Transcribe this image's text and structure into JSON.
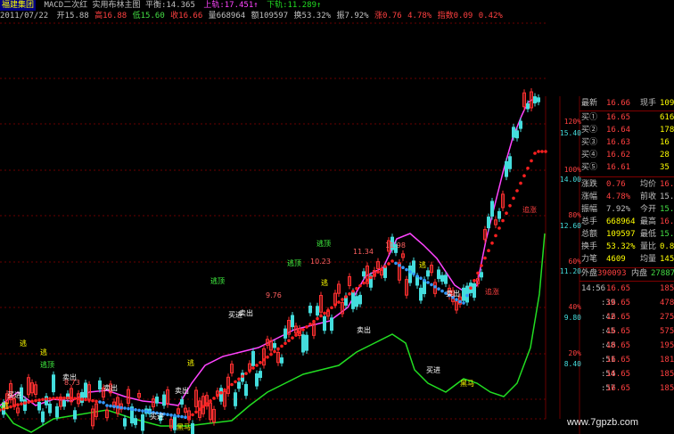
{
  "header": {
    "stock_name": "福建集团",
    "indicator_line": "MACD二次红  实用布林主图  平衡:14.365",
    "upper_label": "上轨:17.451↑",
    "lower_label": "下轨:11.289↑",
    "date": "2011/07/22",
    "open_label": "开15.88",
    "high_label": "高16.88",
    "low_label": "低15.60",
    "close_label": "收16.66",
    "volume_label": "量668964",
    "amount_label": "额109597",
    "turnover_label": "换53.32%",
    "amplitude_label": "振7.92%",
    "rise_label": "涨0.76",
    "rise_pct_label": "4.78%",
    "index_label": "指数0.09",
    "index_pct_label": "0.42%"
  },
  "right_axis": {
    "pct_labels": [
      "120%",
      "100%",
      "80%",
      "60%",
      "40%",
      "20%"
    ],
    "price_labels": [
      "15.40",
      "14.00",
      "12.60",
      "11.20",
      "9.80",
      "8.40"
    ]
  },
  "quote_panel": {
    "latest_label": "最新",
    "latest_value": "16.66",
    "now_hand_label": "现手",
    "now_hand_value": "1098",
    "buy_rows": [
      {
        "label": "买①",
        "price": "16.65",
        "vol": "616"
      },
      {
        "label": "买②",
        "price": "16.64",
        "vol": "178"
      },
      {
        "label": "买③",
        "price": "16.63",
        "vol": "16"
      },
      {
        "label": "买④",
        "price": "16.62",
        "vol": "28"
      },
      {
        "label": "买⑤",
        "price": "16.61",
        "vol": "35"
      }
    ],
    "stats": [
      {
        "l1": "涨跌",
        "v1": "0.76",
        "l2": "均价",
        "v2": "16.3"
      },
      {
        "l1": "涨幅",
        "v1": "4.78%",
        "l2": "前收",
        "v2": "15.9"
      },
      {
        "l1": "振幅",
        "v1": "7.92%",
        "l2": "今开",
        "v2": "15.8"
      },
      {
        "l1": "总手",
        "v1": "668964",
        "l2": "最高",
        "v2": "16.8"
      },
      {
        "l1": "总额",
        "v1": "109597",
        "l2": "最低",
        "v2": "15.6"
      },
      {
        "l1": "换手",
        "v1": "53.32%",
        "l2": "量比",
        "v2": "0.8"
      },
      {
        "l1": "力笔",
        "v1": "4609",
        "l2": "均量",
        "v2": "145"
      }
    ],
    "outer_label": "外盘",
    "outer_value": "390093",
    "inner_label": "内盘",
    "inner_value": "27887",
    "ticks": [
      {
        "time": "14:56",
        "price": "16.65",
        "vol": "185"
      },
      {
        "time": ":39",
        "price": "16.65",
        "vol": "478"
      },
      {
        "time": ":42",
        "price": "16.65",
        "vol": "275"
      },
      {
        "time": ":45",
        "price": "16.65",
        "vol": "575"
      },
      {
        "time": ":48",
        "price": "16.65",
        "vol": "195"
      },
      {
        "time": ":51",
        "price": "16.65",
        "vol": "181"
      },
      {
        "time": ":54",
        "price": "16.65",
        "vol": "185"
      },
      {
        "time": ":57",
        "price": "16.65",
        "vol": "185"
      }
    ]
  },
  "chart_annotations": {
    "buy_signals": [
      "逃",
      "逃",
      "逃",
      "逃",
      "逃",
      "逃"
    ],
    "sell_marks": [
      "卖出",
      "卖出",
      "卖出",
      "卖出",
      "卖出",
      "卖出"
    ],
    "buy_marks": [
      "买进",
      "买进",
      "买进",
      "买进"
    ],
    "horse_marks": [
      "黑马",
      "黑马"
    ],
    "chase_marks": [
      "追涨",
      "追涨"
    ],
    "escape_top": [
      "逃顶",
      "逃顶",
      "逃顶",
      "逃顶"
    ],
    "price_labels": [
      "8.73",
      "11.34",
      "10.23",
      "9.76",
      "11.98"
    ]
  },
  "colors": {
    "upper_band": "#ff44ff",
    "lower_band": "#22dd22",
    "mid_red": "#ff2020",
    "mid_blue": "#3399ff",
    "grid": "#6a0000",
    "up_candle": "#ff3030",
    "down_candle": "#44dddd"
  },
  "watermark": "www.7gpzb.com"
}
